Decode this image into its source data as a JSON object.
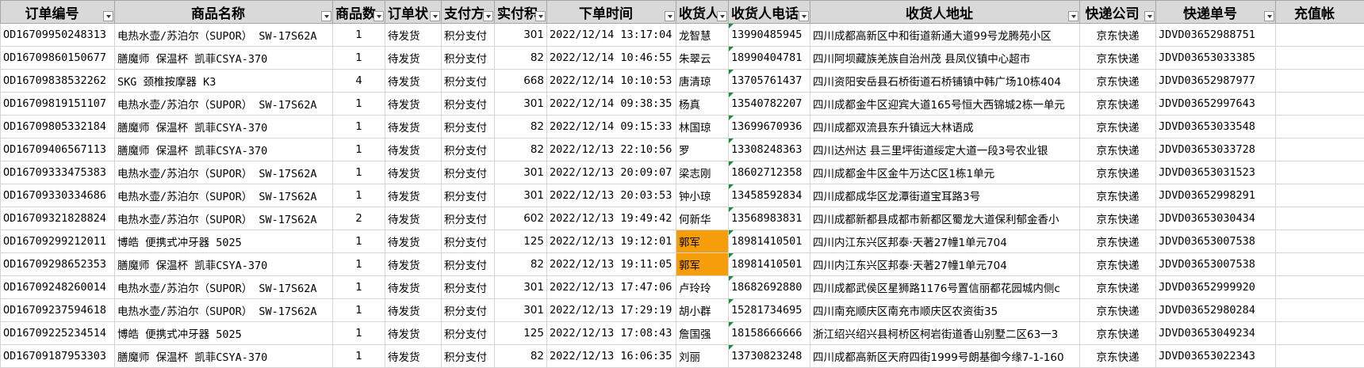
{
  "sheet": {
    "headers": [
      "订单编号",
      "商品名称",
      "商品数",
      "订单状",
      "支付方",
      "实付积",
      "下单时间",
      "收货人",
      "收货人电话",
      "收货人地址",
      "快递公司",
      "快递单号",
      "充值帐"
    ],
    "rows": [
      [
        "OD16709950248313",
        "电热水壶/苏泊尔（SUPOR） SW-17S62A",
        "1",
        "待发货",
        "积分支付",
        "301",
        "2022/12/14 13:17:04",
        "龙智慧",
        "13990485945",
        "四川成都高新区中和街道新通大道99号龙腾苑小区",
        "京东快递",
        "JDVD03652988751",
        ""
      ],
      [
        "OD16709860150677",
        "膳魔师 保温杯 凯菲CSYA-370",
        "1",
        "待发货",
        "积分支付",
        "82",
        "2022/12/14 10:46:55",
        "朱翠云",
        "18990404781",
        "四川阿坝藏族羌族自治州茂  县凤仪镇中心超市",
        "京东快递",
        "JDVD03653033385",
        ""
      ],
      [
        "OD16709838532262",
        "SKG 颈椎按摩器 K3",
        "4",
        "待发货",
        "积分支付",
        "668",
        "2022/12/14 10:10:53",
        "唐清琼",
        "13705761437",
        "四川资阳安岳县石桥街道石桥铺镇中韩广场10栋404",
        "京东快递",
        "JDVD03652987977",
        ""
      ],
      [
        "OD16709819151107",
        "电热水壶/苏泊尔（SUPOR） SW-17S62A",
        "1",
        "待发货",
        "积分支付",
        "301",
        "2022/12/14 09:38:35",
        "杨真",
        "13540782207",
        "四川成都金牛区迎宾大道165号恒大西锦城2栋一单元",
        "京东快递",
        "JDVD03652997643",
        ""
      ],
      [
        "OD16709805332184",
        "膳魔师 保温杯 凯菲CSYA-370",
        "1",
        "待发货",
        "积分支付",
        "82",
        "2022/12/14 09:15:33",
        "林国琼",
        "13699670936",
        "四川成都双流县东升镇远大林语成",
        "京东快递",
        "JDVD03653033548",
        ""
      ],
      [
        "OD16709406567113",
        "膳魔师 保温杯 凯菲CSYA-370",
        "1",
        "待发货",
        "积分支付",
        "82",
        "2022/12/13 22:10:56",
        "罗",
        "13308248363",
        "四川达州达  县三里坪街道绥定大道一段3号农业银",
        "京东快递",
        "JDVD03653033728",
        ""
      ],
      [
        "OD16709333475383",
        "电热水壶/苏泊尔（SUPOR） SW-17S62A",
        "1",
        "待发货",
        "积分支付",
        "301",
        "2022/12/13 20:09:07",
        "梁志刚",
        "18602712358",
        "四川成都金牛区金牛万达C区1栋1单元",
        "京东快递",
        "JDVD03653031523",
        ""
      ],
      [
        "OD16709330334686",
        "电热水壶/苏泊尔（SUPOR） SW-17S62A",
        "1",
        "待发货",
        "积分支付",
        "301",
        "2022/12/13 20:03:53",
        "钟小琼",
        "13458592834",
        "四川成都成华区龙潭街道宝耳路3号",
        "京东快递",
        "JDVD03652998291",
        ""
      ],
      [
        "OD16709321828824",
        "电热水壶/苏泊尔（SUPOR） SW-17S62A",
        "2",
        "待发货",
        "积分支付",
        "602",
        "2022/12/13 19:49:42",
        "何新华",
        "13568983831",
        "四川成都新都县成都市新都区蜀龙大道保利郁金香小",
        "京东快递",
        "JDVD03653030434",
        ""
      ],
      [
        "OD16709299212011",
        "博皓 便携式冲牙器 5025",
        "1",
        "待发货",
        "积分支付",
        "125",
        "2022/12/13 19:12:01",
        "郭军",
        "18981410501",
        "四川内江东兴区邦泰·天著27幢1单元704",
        "京东快递",
        "JDVD03653007538",
        ""
      ],
      [
        "OD16709298652353",
        "膳魔师 保温杯 凯菲CSYA-370",
        "1",
        "待发货",
        "积分支付",
        "82",
        "2022/12/13 19:11:05",
        "郭军",
        "18981410501",
        "四川内江东兴区邦泰·天著27幢1单元704",
        "京东快递",
        "JDVD03653007538",
        ""
      ],
      [
        "OD16709248260014",
        "电热水壶/苏泊尔（SUPOR） SW-17S62A",
        "1",
        "待发货",
        "积分支付",
        "301",
        "2022/12/13 17:47:06",
        "卢玲玲",
        "18682692880",
        "四川成都武侯区星狮路1176号置信丽都花园城内侧c",
        "京东快递",
        "JDVD03652999920",
        ""
      ],
      [
        "OD16709237594618",
        "电热水壶/苏泊尔（SUPOR） SW-17S62A",
        "1",
        "待发货",
        "积分支付",
        "301",
        "2022/12/13 17:29:19",
        "胡小群",
        "15281734695",
        "四川南充顺庆区南充市顺庆区农资街35",
        "京东快递",
        "JDVD03652980284",
        ""
      ],
      [
        "OD16709225234514",
        "博皓 便携式冲牙器 5025",
        "1",
        "待发货",
        "积分支付",
        "125",
        "2022/12/13 17:08:43",
        "詹国强",
        "18158666666",
        "浙江绍兴绍兴县柯桥区柯岩街道香山别墅二区63一3",
        "京东快递",
        "JDVD03653049234",
        ""
      ],
      [
        "OD16709187953303",
        "膳魔师 保温杯 凯菲CSYA-370",
        "1",
        "待发货",
        "积分支付",
        "82",
        "2022/12/13 16:06:35",
        "刘丽",
        "13730823248",
        "四川成都高新区天府四街1999号朗基御今缘7-1-160",
        "京东快递",
        "JDVD03653022343",
        ""
      ]
    ],
    "highlight_color": "#f59d0a",
    "highlighted_rows": [
      9,
      10
    ]
  }
}
